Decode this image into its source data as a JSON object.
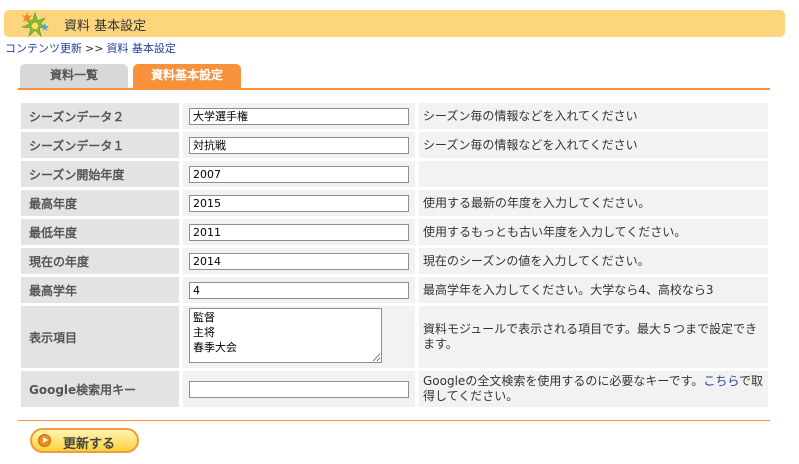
{
  "header": {
    "logo_icon": "sparkle-icon",
    "title": "資料 基本設定"
  },
  "breadcrumb": {
    "items": [
      "コンテンツ更新",
      "資料 基本設定"
    ],
    "separator": ">>"
  },
  "tabs": [
    {
      "label": "資料一覧",
      "active": false
    },
    {
      "label": "資料基本設定",
      "active": true
    }
  ],
  "form": {
    "rows": [
      {
        "label": "シーズンデータ２",
        "value": "大学選手権",
        "desc": "シーズン毎の情報などを入れてください"
      },
      {
        "label": "シーズンデータ１",
        "value": "対抗戦",
        "desc": "シーズン毎の情報などを入れてください"
      },
      {
        "label": "シーズン開始年度",
        "value": "2007",
        "desc": ""
      },
      {
        "label": "最高年度",
        "value": "2015",
        "desc": "使用する最新の年度を入力してください。"
      },
      {
        "label": "最低年度",
        "value": "2011",
        "desc": "使用するもっとも古い年度を入力してください。"
      },
      {
        "label": "現在の年度",
        "value": "2014",
        "desc": "現在のシーズンの値を入力してください。"
      },
      {
        "label": "最高学年",
        "value": "4",
        "desc": "最高学年を入力してください。大学なら4、高校なら3"
      }
    ],
    "display_items": {
      "label": "表示項目",
      "value": "監督\n主将\n春季大会",
      "desc": "資料モジュールで表示される項目です。最大５つまで設定できます。"
    },
    "google_key": {
      "label": "Google検索用キー",
      "value": "",
      "desc_before": "Googleの全文検索を使用するのに必要なキーです。",
      "desc_link": "こちら",
      "desc_after": "で取得してください。"
    }
  },
  "actions": {
    "update_label": "更新する"
  },
  "colors": {
    "header_bg": "#fcd57c",
    "accent": "#f7913c",
    "link": "#1f3f9e"
  }
}
